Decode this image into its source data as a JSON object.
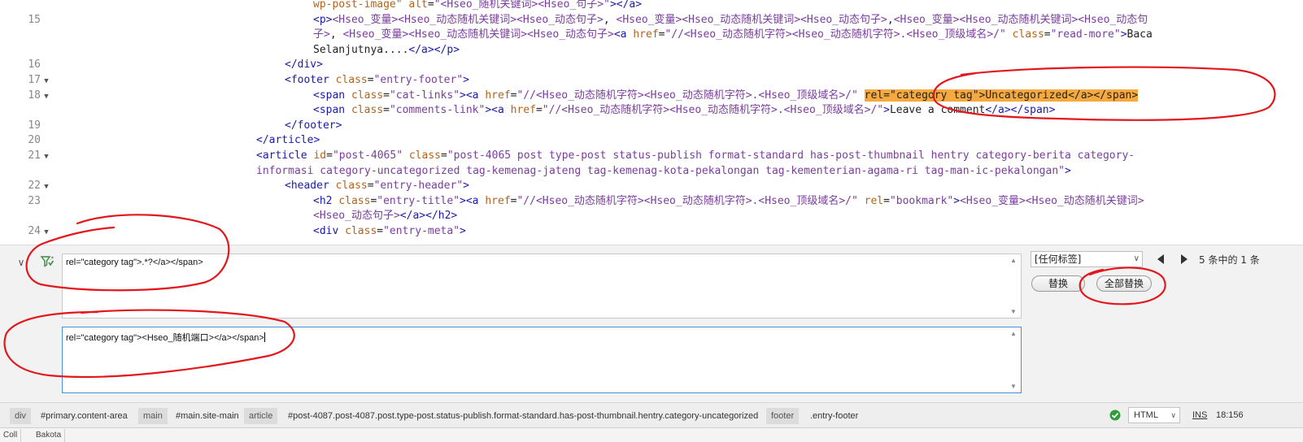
{
  "editor": {
    "gutter": [
      {
        "num": "15",
        "fold": false
      },
      {
        "num": "16",
        "fold": false
      },
      {
        "num": "17",
        "fold": true
      },
      {
        "num": "18",
        "fold": true
      },
      {
        "num": "19",
        "fold": false
      },
      {
        "num": "20",
        "fold": false
      },
      {
        "num": "21",
        "fold": true
      },
      {
        "num": "22",
        "fold": true
      },
      {
        "num": "23",
        "fold": false
      },
      {
        "num": "24",
        "fold": true
      }
    ],
    "lines": [
      {
        "indent": 385,
        "segments": [
          [
            "attr",
            "wp-post-image\""
          ],
          [
            "txt",
            " "
          ],
          [
            "attr",
            "alt"
          ],
          [
            "txt",
            "="
          ],
          [
            "val",
            "\"<Hseo_随机关键词><Hseo_句子>\""
          ],
          [
            "tag",
            "></a>"
          ]
        ]
      },
      {
        "indent": 385,
        "segments": [
          [
            "tag",
            "<p>"
          ],
          [
            "val",
            "<Hseo_变量><Hseo_动态随机关键词><Hseo_动态句子>"
          ],
          [
            "txt",
            ", "
          ],
          [
            "val",
            "<Hseo_变量><Hseo_动态随机关键词><Hseo_动态句子>"
          ],
          [
            "txt",
            ","
          ],
          [
            "val",
            "<Hseo_变量><Hseo_动态随机关键词><Hseo_动态句"
          ]
        ]
      },
      {
        "indent": 385,
        "segments": [
          [
            "val",
            "子>"
          ],
          [
            "txt",
            ", "
          ],
          [
            "val",
            "<Hseo_变量><Hseo_动态随机关键词><Hseo_动态句子>"
          ],
          [
            "tag",
            "<a "
          ],
          [
            "attr",
            "href"
          ],
          [
            "txt",
            "="
          ],
          [
            "val",
            "\"//<Hseo_动态随机字符><Hseo_动态随机字符>.<Hseo_顶级域名>/\""
          ],
          [
            "txt",
            " "
          ],
          [
            "attr",
            "class"
          ],
          [
            "txt",
            "="
          ],
          [
            "val",
            "\"read-more\""
          ],
          [
            "tag",
            ">"
          ],
          [
            "txt",
            "Baca"
          ]
        ]
      },
      {
        "indent": 385,
        "segments": [
          [
            "txt",
            "Selanjutnya...."
          ],
          [
            "tag",
            "</a></p>"
          ]
        ]
      },
      {
        "indent": 350,
        "segments": [
          [
            "tag",
            "</div>"
          ]
        ]
      },
      {
        "indent": 350,
        "segments": [
          [
            "tag",
            "<footer "
          ],
          [
            "attr",
            "class"
          ],
          [
            "txt",
            "="
          ],
          [
            "val",
            "\"entry-footer\""
          ],
          [
            "tag",
            ">"
          ]
        ]
      },
      {
        "indent": 385,
        "segments": [
          [
            "tag",
            "<span "
          ],
          [
            "attr",
            "class"
          ],
          [
            "txt",
            "="
          ],
          [
            "val",
            "\"cat-links\""
          ],
          [
            "tag",
            "><a "
          ],
          [
            "attr",
            "href"
          ],
          [
            "txt",
            "="
          ],
          [
            "val",
            "\"//<Hseo_动态随机字符><Hseo_动态随机字符>.<Hseo_顶级域名>/\""
          ],
          [
            "txt",
            " "
          ],
          [
            "hl",
            "rel=\"category tag\">Uncategorized</a></span>"
          ]
        ]
      },
      {
        "indent": 385,
        "segments": [
          [
            "tag",
            "<span "
          ],
          [
            "attr",
            "class"
          ],
          [
            "txt",
            "="
          ],
          [
            "val",
            "\"comments-link\""
          ],
          [
            "tag",
            "><a "
          ],
          [
            "attr",
            "href"
          ],
          [
            "txt",
            "="
          ],
          [
            "val",
            "\"//<Hseo_动态随机字符><Hseo_动态随机字符>.<Hseo_顶级域名>/\""
          ],
          [
            "tag",
            ">"
          ],
          [
            "txt",
            "Leave a comment"
          ],
          [
            "tag",
            "</a></span>"
          ]
        ]
      },
      {
        "indent": 350,
        "segments": [
          [
            "tag",
            "</footer>"
          ]
        ]
      },
      {
        "indent": 315,
        "segments": [
          [
            "tag",
            "</article>"
          ]
        ]
      },
      {
        "indent": 315,
        "segments": [
          [
            "tag",
            "<article "
          ],
          [
            "attr",
            "id"
          ],
          [
            "txt",
            "="
          ],
          [
            "val",
            "\"post-4065\""
          ],
          [
            "txt",
            " "
          ],
          [
            "attr",
            "class"
          ],
          [
            "txt",
            "="
          ],
          [
            "val",
            "\"post-4065 post type-post status-publish format-standard has-post-thumbnail hentry category-berita category-"
          ]
        ]
      },
      {
        "indent": 315,
        "segments": [
          [
            "val",
            "informasi category-uncategorized tag-kemenag-jateng tag-kemenag-kota-pekalongan tag-kementerian-agama-ri tag-man-ic-pekalongan\""
          ],
          [
            "tag",
            ">"
          ]
        ]
      },
      {
        "indent": 350,
        "segments": [
          [
            "tag",
            "<header "
          ],
          [
            "attr",
            "class"
          ],
          [
            "txt",
            "="
          ],
          [
            "val",
            "\"entry-header\""
          ],
          [
            "tag",
            ">"
          ]
        ]
      },
      {
        "indent": 385,
        "segments": [
          [
            "tag",
            "<h2 "
          ],
          [
            "attr",
            "class"
          ],
          [
            "txt",
            "="
          ],
          [
            "val",
            "\"entry-title\""
          ],
          [
            "tag",
            "><a "
          ],
          [
            "attr",
            "href"
          ],
          [
            "txt",
            "="
          ],
          [
            "val",
            "\"//<Hseo_动态随机字符><Hseo_动态随机字符>.<Hseo_顶级域名>/\""
          ],
          [
            "txt",
            " "
          ],
          [
            "attr",
            "rel"
          ],
          [
            "txt",
            "="
          ],
          [
            "val",
            "\"bookmark\""
          ],
          [
            "tag",
            ">"
          ],
          [
            "val",
            "<Hseo_变量><Hseo_动态随机关键词>"
          ]
        ]
      },
      {
        "indent": 385,
        "segments": [
          [
            "val",
            "<Hseo_动态句子>"
          ],
          [
            "tag",
            "</a></h2>"
          ]
        ]
      },
      {
        "indent": 385,
        "segments": [
          [
            "tag",
            "<div "
          ],
          [
            "attr",
            "class"
          ],
          [
            "txt",
            "="
          ],
          [
            "val",
            "\"entry-meta\""
          ],
          [
            "tag",
            ">"
          ]
        ]
      }
    ]
  },
  "find_panel": {
    "find_value": "rel=\"category tag\">.*?</a></span>",
    "replace_value": "rel=\"category tag\"><Hseo_随机端口></a></span>",
    "tag_filter": "[任何标签]",
    "match_count": "5 条中的 1 条",
    "replace_label": "替换",
    "replace_all_label": "全部替换"
  },
  "status_bar": {
    "crumbs": [
      {
        "kind": "tagname",
        "text": "div"
      },
      {
        "kind": "sel",
        "text": "#primary.content-area"
      },
      {
        "kind": "tagname",
        "text": "main"
      },
      {
        "kind": "sel",
        "text": "#main.site-main"
      },
      {
        "kind": "tagname",
        "text": "article"
      },
      {
        "kind": "sel",
        "text": "#post-4087.post-4087.post.type-post.status-publish.format-standard.has-post-thumbnail.hentry.category-uncategorized"
      },
      {
        "kind": "tagname",
        "text": "footer"
      },
      {
        "kind": "sel",
        "text": ".entry-footer"
      }
    ],
    "language": "HTML",
    "ins_mode": "INS",
    "cursor_pos": "18:156"
  },
  "bottom_tabs": [
    "Coll",
    "Bakota"
  ],
  "colors": {
    "tag": "#1a1aa6",
    "attribute": "#b2641d",
    "value": "#7a3d9e",
    "highlight": "#f5a93e",
    "annotation": "#e3171b"
  }
}
